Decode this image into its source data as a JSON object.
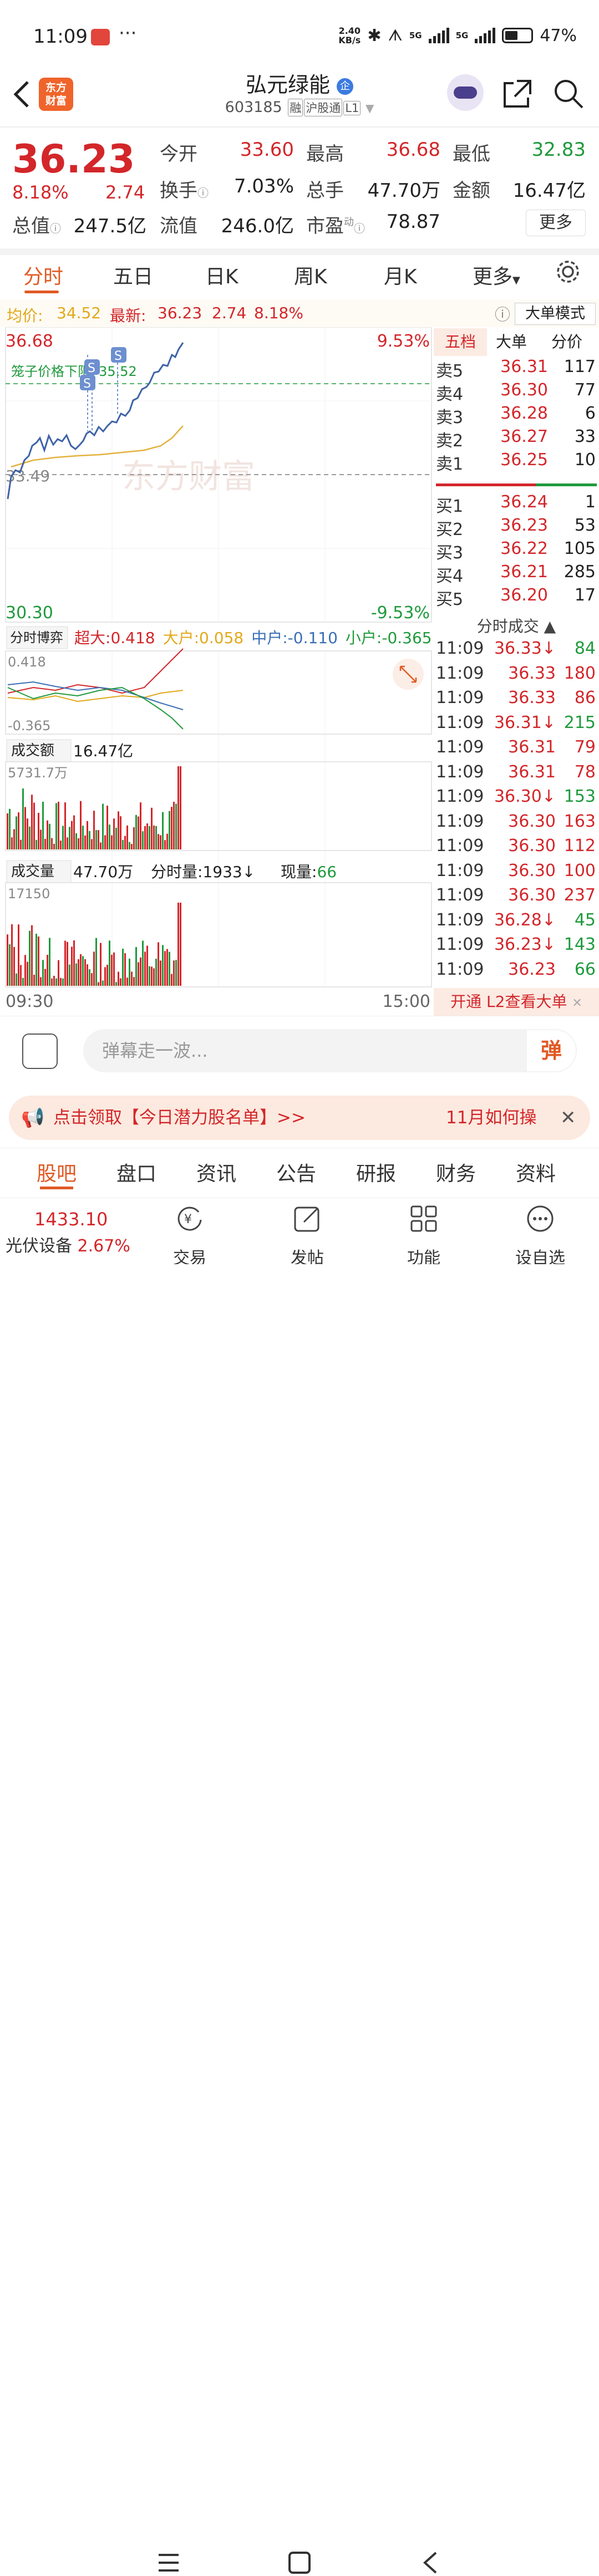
{
  "status": {
    "time": "11:09",
    "dots": "···",
    "speed_top": "2.40",
    "speed_bottom": "KB/s",
    "net1": "5G",
    "net2": "5G",
    "battery": "47%"
  },
  "header": {
    "logo_line1": "东方",
    "logo_line2": "财富",
    "title": "弘元绿能",
    "badge": "企",
    "code": "603185",
    "tags": [
      "融",
      "沪股通",
      "L1"
    ]
  },
  "quote": {
    "price": "36.23",
    "change_pct": "8.18%",
    "change": "2.74",
    "fields": [
      {
        "label": "今开",
        "value": "33.60",
        "color": "red"
      },
      {
        "label": "最高",
        "value": "36.68",
        "color": "red"
      },
      {
        "label": "最低",
        "value": "32.83",
        "color": "green"
      },
      {
        "label": "换手",
        "value": "7.03%",
        "color": "dark"
      },
      {
        "label": "总手",
        "value": "47.70万",
        "color": "dark"
      },
      {
        "label": "金额",
        "value": "16.47亿",
        "color": "dark"
      },
      {
        "label": "总值",
        "value": "247.5亿",
        "color": "dark"
      },
      {
        "label": "流值",
        "value": "246.0亿",
        "color": "dark"
      },
      {
        "label": "市盈",
        "value": "78.87",
        "color": "dark"
      }
    ],
    "pe_sup": "动",
    "more": "更多"
  },
  "tabs": [
    "分时",
    "五日",
    "日K",
    "周K",
    "月K",
    "更多"
  ],
  "avgbar": {
    "avg_label": "均价:",
    "avg": "34.52",
    "latest_label": "最新:",
    "latest": "36.23",
    "chg": "2.74",
    "pct": "8.18%",
    "mode": "大单模式"
  },
  "chart": {
    "high": "36.68",
    "low": "30.30",
    "pct_up": "9.53%",
    "pct_down": "-9.53%",
    "prev_close": "33.49",
    "limit_label": "笼子价格下限:",
    "limit_value": "35.52",
    "watermark": "东方财富",
    "s_marker": "S",
    "time_start": "09:30",
    "time_end": "15:00"
  },
  "flow": {
    "dropdown": "分时博弈",
    "labels": [
      {
        "name": "超大:",
        "value": "0.418",
        "color": "#d3262a"
      },
      {
        "name": "大户:",
        "value": "0.058",
        "color": "#e3a81b"
      },
      {
        "name": "中户:",
        "value": "-0.110",
        "color": "#3a6fb6"
      },
      {
        "name": "小户:",
        "value": "-0.365",
        "color": "#1f9a3c"
      }
    ],
    "max": "0.418",
    "min": "-0.365"
  },
  "amount": {
    "dropdown": "成交额",
    "value": "16.47亿",
    "max": "5731.7万"
  },
  "volume": {
    "dropdown": "成交量",
    "value": "47.70万",
    "fs_label": "分时量:",
    "fs_value": "1933",
    "arrow": "↓",
    "now_label": "现量:",
    "now_value": "66",
    "max": "17150"
  },
  "book": {
    "tabs": [
      "五档",
      "大单",
      "分价"
    ],
    "asks": [
      {
        "label": "卖5",
        "price": "36.31",
        "vol": "117"
      },
      {
        "label": "卖4",
        "price": "36.30",
        "vol": "77"
      },
      {
        "label": "卖3",
        "price": "36.28",
        "vol": "6"
      },
      {
        "label": "卖2",
        "price": "36.27",
        "vol": "33"
      },
      {
        "label": "卖1",
        "price": "36.25",
        "vol": "10"
      }
    ],
    "bids": [
      {
        "label": "买1",
        "price": "36.24",
        "vol": "1"
      },
      {
        "label": "买2",
        "price": "36.23",
        "vol": "53"
      },
      {
        "label": "买3",
        "price": "36.22",
        "vol": "105"
      },
      {
        "label": "买4",
        "price": "36.21",
        "vol": "285"
      },
      {
        "label": "买5",
        "price": "36.20",
        "vol": "17"
      }
    ],
    "trades_title": "分时成交",
    "trades": [
      {
        "t": "11:09",
        "p": "36.33↓",
        "v": "84",
        "c": "g"
      },
      {
        "t": "11:09",
        "p": "36.33",
        "v": "180",
        "c": "r"
      },
      {
        "t": "11:09",
        "p": "36.33",
        "v": "86",
        "c": "r"
      },
      {
        "t": "11:09",
        "p": "36.31↓",
        "v": "215",
        "c": "g"
      },
      {
        "t": "11:09",
        "p": "36.31",
        "v": "79",
        "c": "r"
      },
      {
        "t": "11:09",
        "p": "36.31",
        "v": "78",
        "c": "r"
      },
      {
        "t": "11:09",
        "p": "36.30↓",
        "v": "153",
        "c": "g"
      },
      {
        "t": "11:09",
        "p": "36.30",
        "v": "163",
        "c": "r"
      },
      {
        "t": "11:09",
        "p": "36.30",
        "v": "112",
        "c": "r"
      },
      {
        "t": "11:09",
        "p": "36.30",
        "v": "100",
        "c": "r"
      },
      {
        "t": "11:09",
        "p": "36.30",
        "v": "237",
        "c": "r"
      },
      {
        "t": "11:09",
        "p": "36.28↓",
        "v": "45",
        "c": "g"
      },
      {
        "t": "11:09",
        "p": "36.23↓",
        "v": "143",
        "c": "g"
      },
      {
        "t": "11:09",
        "p": "36.23",
        "v": "66",
        "c": "g"
      }
    ],
    "l2": "开通 L2查看大单"
  },
  "danmu": {
    "placeholder": "弹幕走一波...",
    "btn": "弹"
  },
  "banner": {
    "text": "点击领取【今日潜力股名单】>>",
    "right": "11月如何操"
  },
  "bottom_tabs": [
    "股吧",
    "盘口",
    "资讯",
    "公告",
    "研报",
    "财务",
    "资料"
  ],
  "footer": {
    "index_value": "1433.10",
    "index_name": "光伏设备",
    "index_pct": "2.67%",
    "items": [
      "交易",
      "发帖",
      "功能",
      "设自选"
    ]
  }
}
